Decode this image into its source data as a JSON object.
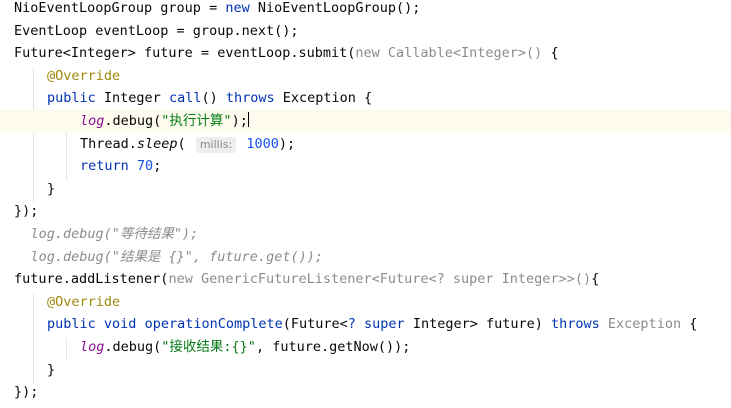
{
  "lines": [
    {
      "tokens": [
        {
          "t": "NioEventLoopGroup group = "
        },
        {
          "t": "new",
          "c": "kw"
        },
        {
          "t": " NioEventLoopGroup();"
        }
      ]
    },
    {
      "tokens": [
        {
          "t": "EventLoop eventLoop = group.next();"
        }
      ]
    },
    {
      "tokens": [
        {
          "t": "Future<Integer> future = eventLoop.submit("
        },
        {
          "t": "new Callable<Integer>()",
          "c": "gray"
        },
        {
          "t": " {"
        }
      ]
    },
    {
      "indent": 1,
      "tokens": [
        {
          "t": "@Override",
          "c": "ann"
        }
      ]
    },
    {
      "indent": 1,
      "tokens": [
        {
          "t": "public",
          "c": "kw"
        },
        {
          "t": " Integer "
        },
        {
          "t": "call",
          "c": "kw"
        },
        {
          "t": "() "
        },
        {
          "t": "throws",
          "c": "kw"
        },
        {
          "t": " Exception {"
        }
      ]
    },
    {
      "indent": 2,
      "current": true,
      "tokens": [
        {
          "t": "log",
          "c": "field"
        },
        {
          "t": ".debug("
        },
        {
          "t": "\"执行计算\"",
          "c": "str"
        },
        {
          "t": ");"
        },
        {
          "t": "",
          "c": "caret"
        }
      ]
    },
    {
      "indent": 2,
      "tokens": [
        {
          "t": "Thread."
        },
        {
          "t": "sleep",
          "c": "it"
        },
        {
          "t": "( "
        },
        {
          "t": "millis:",
          "c": "hint"
        },
        {
          "t": " "
        },
        {
          "t": "1000",
          "c": "num"
        },
        {
          "t": ");"
        }
      ]
    },
    {
      "indent": 2,
      "tokens": [
        {
          "t": "return",
          "c": "kw"
        },
        {
          "t": " "
        },
        {
          "t": "70",
          "c": "num"
        },
        {
          "t": ";"
        }
      ]
    },
    {
      "indent": 1,
      "tokens": [
        {
          "t": "}"
        }
      ]
    },
    {
      "tokens": [
        {
          "t": "});"
        }
      ]
    },
    {
      "indent": 0.5,
      "tokens": [
        {
          "t": "log.debug(\"等待结果\");",
          "c": "comment"
        }
      ]
    },
    {
      "indent": 0.5,
      "tokens": [
        {
          "t": "log.debug(\"结果是 {}\", future.get());",
          "c": "comment"
        }
      ]
    },
    {
      "tokens": [
        {
          "t": "future.addListener("
        },
        {
          "t": "new GenericFutureListener<Future<? super Integer>>()",
          "c": "gray"
        },
        {
          "t": "{"
        }
      ]
    },
    {
      "indent": 1,
      "tokens": [
        {
          "t": "@Override",
          "c": "ann"
        }
      ]
    },
    {
      "indent": 1,
      "tokens": [
        {
          "t": "public",
          "c": "kw"
        },
        {
          "t": " "
        },
        {
          "t": "void",
          "c": "kw"
        },
        {
          "t": " "
        },
        {
          "t": "operationComplete",
          "c": "kw"
        },
        {
          "t": "(Future<"
        },
        {
          "t": "? super",
          "c": "kw"
        },
        {
          "t": " Integer> future) "
        },
        {
          "t": "throws",
          "c": "kw"
        },
        {
          "t": " "
        },
        {
          "t": "Exception",
          "c": "gray"
        },
        {
          "t": " {"
        }
      ]
    },
    {
      "indent": 2,
      "tokens": [
        {
          "t": "log",
          "c": "field"
        },
        {
          "t": ".debug("
        },
        {
          "t": "\"接收结果:{}\"",
          "c": "str"
        },
        {
          "t": ", future.getNow());"
        }
      ]
    },
    {
      "indent": 1,
      "tokens": [
        {
          "t": "}"
        }
      ]
    },
    {
      "tokens": [
        {
          "t": "});"
        }
      ]
    }
  ]
}
